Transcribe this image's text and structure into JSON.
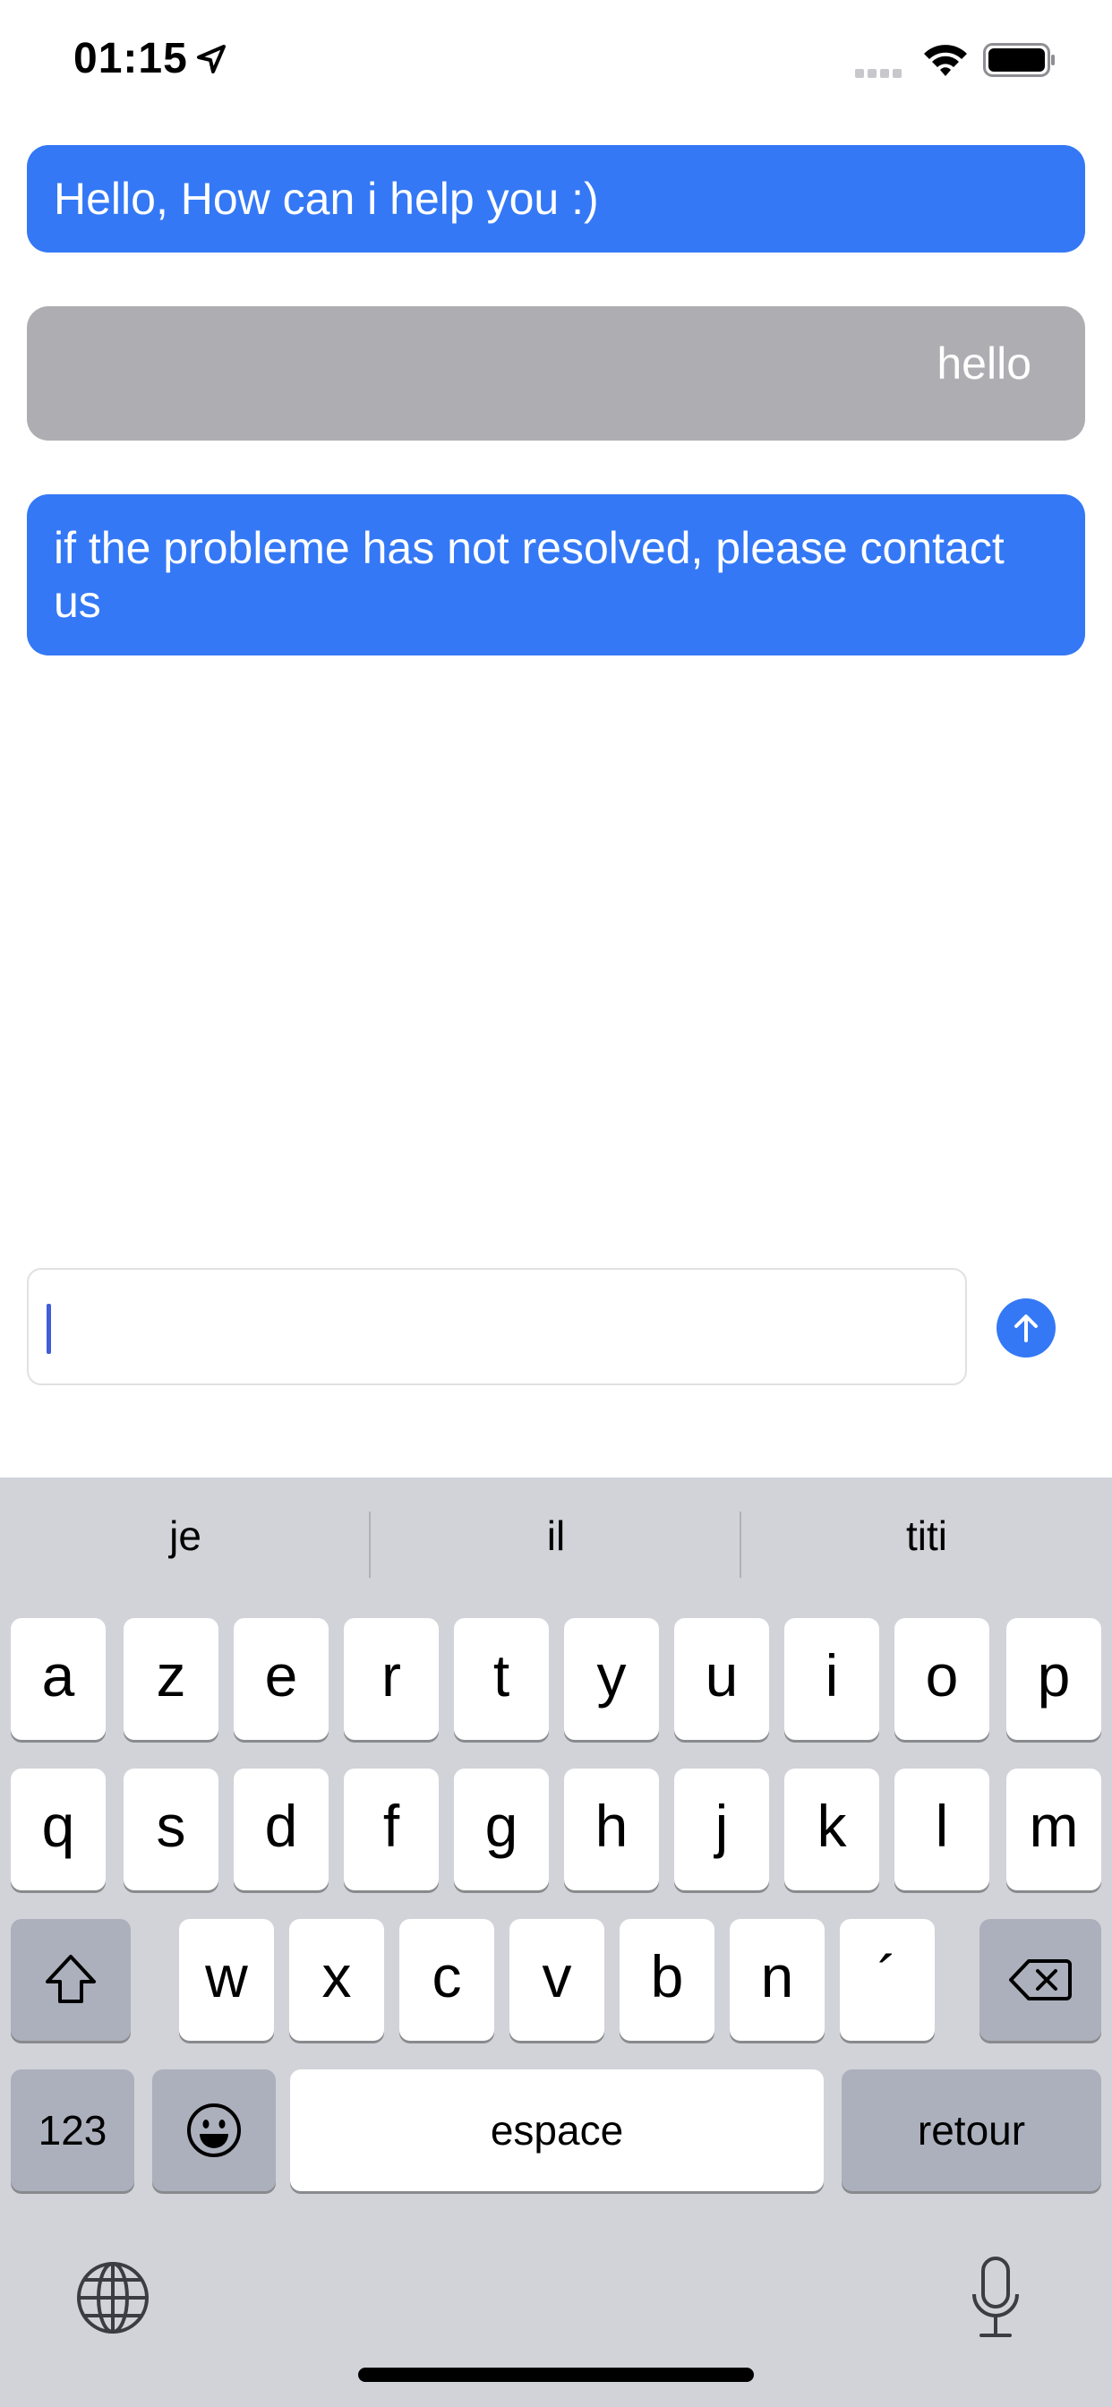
{
  "status_bar": {
    "time": "01:15"
  },
  "messages": [
    {
      "sender": "bot",
      "text": "Hello, How can i help you :)"
    },
    {
      "sender": "user",
      "text": "hello"
    },
    {
      "sender": "bot",
      "text": "if the probleme has not resolved, please contact us"
    }
  ],
  "composer": {
    "value": "",
    "placeholder": ""
  },
  "keyboard": {
    "suggestions": [
      "je",
      "il",
      "titi"
    ],
    "row1": [
      "a",
      "z",
      "e",
      "r",
      "t",
      "y",
      "u",
      "i",
      "o",
      "p"
    ],
    "row2": [
      "q",
      "s",
      "d",
      "f",
      "g",
      "h",
      "j",
      "k",
      "l",
      "m"
    ],
    "row3": [
      "w",
      "x",
      "c",
      "v",
      "b",
      "n",
      "´"
    ],
    "numbers_key": "123",
    "space_key": "espace",
    "return_key": "retour"
  },
  "icons": {
    "location": "location-arrow-icon",
    "signal": "cellular-signal-icon",
    "wifi": "wifi-icon",
    "battery": "battery-icon",
    "send": "arrow-up-icon",
    "shift": "shift-icon",
    "delete": "delete-backspace-icon",
    "emoji": "emoji-icon",
    "globe": "globe-icon",
    "mic": "microphone-icon"
  },
  "colors": {
    "bot_bubble": "#3478f6",
    "user_bubble": "#aeaeb2",
    "keyboard_bg": "#d1d3d9",
    "send_button": "#3478f6"
  }
}
